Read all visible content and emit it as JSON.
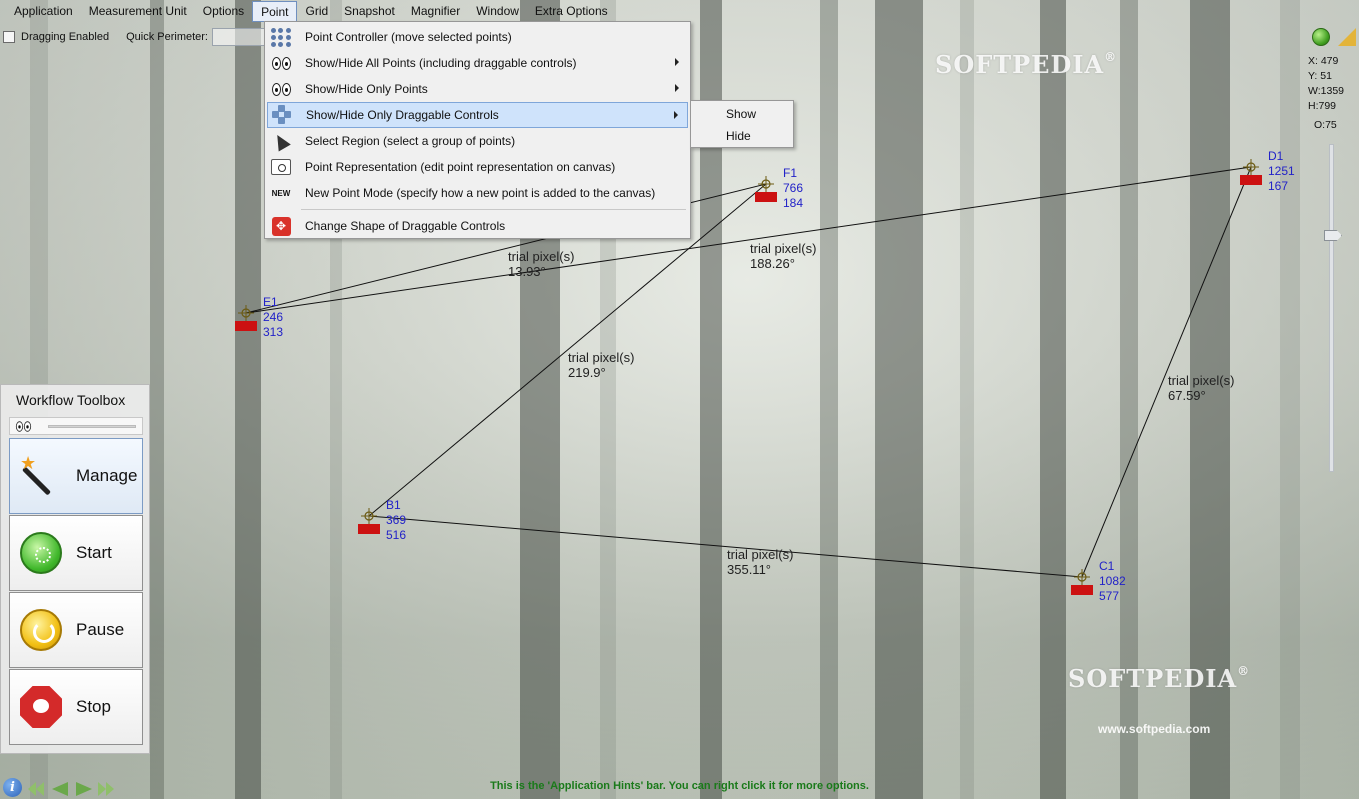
{
  "menubar": {
    "items": [
      "Application",
      "Measurement Unit",
      "Options",
      "Point",
      "Grid",
      "Snapshot",
      "Magnifier",
      "Window",
      "Extra Options"
    ],
    "active": "Point"
  },
  "toolbar": {
    "dragging_label": "Dragging Enabled",
    "perimeter_label": "Quick Perimeter:",
    "perimeter_value": ""
  },
  "info_panel": {
    "x": "X: 479",
    "y": "Y: 51",
    "w": "W:1359",
    "h": "H:799",
    "o": "O:75"
  },
  "point_menu": {
    "items": [
      {
        "label": "Point Controller (move selected points)",
        "icon": "dots-grid-icon",
        "submenu": false
      },
      {
        "label": "Show/Hide All Points (including draggable controls)",
        "icon": "eyes-icon",
        "submenu": true
      },
      {
        "label": "Show/Hide Only Points",
        "icon": "eyes-icon",
        "submenu": true
      },
      {
        "label": "Show/Hide Only Draggable Controls",
        "icon": "move-controls-icon",
        "submenu": true
      },
      {
        "label": "Select Region (select a group of points)",
        "icon": "cursor-icon",
        "submenu": false
      },
      {
        "label": "Point Representation (edit point representation on canvas)",
        "icon": "representation-icon",
        "submenu": false
      },
      {
        "label": "New Point Mode (specify how a new point is added to the canvas)",
        "icon": "new-icon",
        "submenu": false
      },
      {
        "label": "Change Shape of Draggable Controls",
        "icon": "shape-icon",
        "submenu": false
      }
    ],
    "new_icon_text": "NEW"
  },
  "submenu": {
    "items": [
      "Show",
      "Hide"
    ]
  },
  "points": [
    {
      "name": "F1",
      "x": "766",
      "y": "184"
    },
    {
      "name": "D1",
      "x": "1251",
      "y": "167"
    },
    {
      "name": "E1",
      "x": "246",
      "y": "313"
    },
    {
      "name": "B1",
      "x": "369",
      "y": "516"
    },
    {
      "name": "C1",
      "x": "1082",
      "y": "577"
    }
  ],
  "segments": [
    {
      "unit": "trial pixel(s)",
      "angle": "13.93°"
    },
    {
      "unit": "trial pixel(s)",
      "angle": "188.26°"
    },
    {
      "unit": "trial pixel(s)",
      "angle": "219.9°"
    },
    {
      "unit": "trial pixel(s)",
      "angle": "67.59°"
    },
    {
      "unit": "trial pixel(s)",
      "angle": "355.11°"
    }
  ],
  "watermark": {
    "brand": "SOFTPEDIA",
    "registered": "®",
    "url": "www.softpedia.com"
  },
  "toolbox": {
    "title": "Workflow Toolbox",
    "buttons": [
      {
        "label": "Manage",
        "icon": "magic-wand-icon"
      },
      {
        "label": "Start",
        "icon": "start-icon"
      },
      {
        "label": "Pause",
        "icon": "pause-icon"
      },
      {
        "label": "Stop",
        "icon": "stop-icon"
      }
    ]
  },
  "hint_bar": "This is the 'Application Hints' bar. You can right click it for more options.",
  "colors": {
    "point_label": "#2222c8",
    "marker": "#cc1111",
    "hint_text": "#1a7a1a",
    "menu_highlight": "#cfe3fb"
  }
}
